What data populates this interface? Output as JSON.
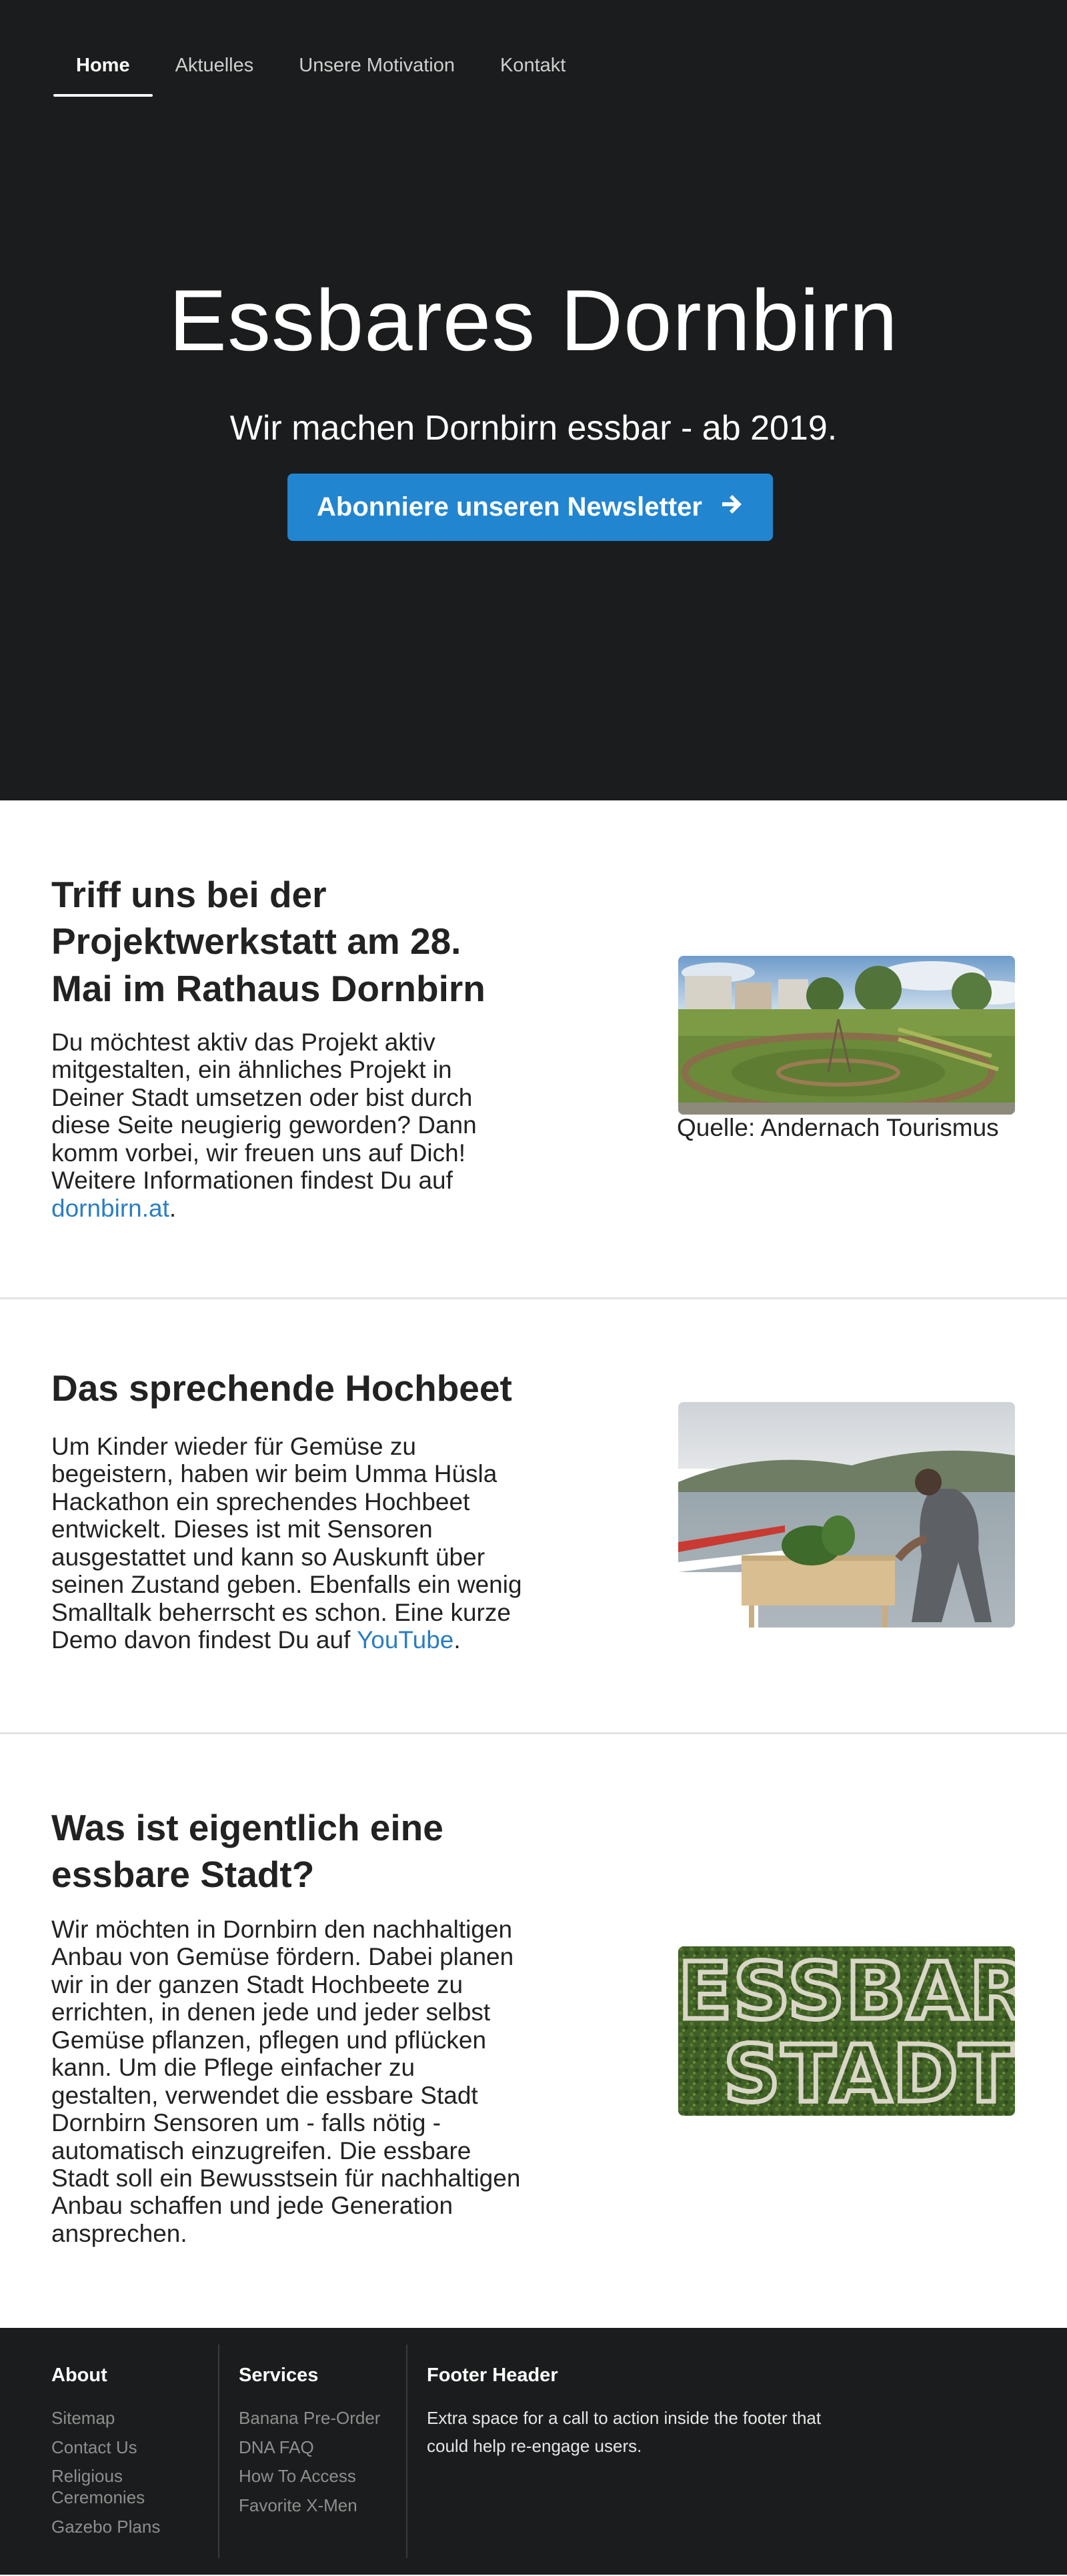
{
  "nav": {
    "items": [
      {
        "label": "Home"
      },
      {
        "label": "Aktuelles"
      },
      {
        "label": "Unsere Motivation"
      },
      {
        "label": "Kontakt"
      }
    ]
  },
  "hero": {
    "title": "Essbares Dornbirn",
    "subtitle": "Wir machen Dornbirn essbar - ab 2019.",
    "cta_label": "Abonniere unseren Newsletter",
    "cta_icon": "arrow-right-icon"
  },
  "sections": [
    {
      "title": "Triff uns bei der Projektwerkstatt am 28. Mai im Rathaus Dornbirn",
      "text": "Du möchtest aktiv das Projekt aktiv mitgestalten, ein ähnliches Projekt in Deiner Stadt umsetzen oder bist durch diese Seite neugierig geworden? Dann komm vorbei, wir freuen uns auf Dich! Weitere Informationen findest Du auf ",
      "link": "dornbirn.at",
      "after": ".",
      "caption": "Quelle: Andernach Tourismus"
    },
    {
      "title": "Das sprechende Hochbeet",
      "text": "Um Kinder wieder für Gemüse zu begeistern, haben wir beim Umma Hüsla Hackathon ein sprechendes Hochbeet entwickelt. Dieses ist mit Sensoren ausgestattet und kann so Auskunft über seinen Zustand geben. Ebenfalls ein wenig Smalltalk beherrscht es schon. Eine kurze Demo davon findest Du auf ",
      "link": "YouTube",
      "after": "."
    },
    {
      "title": "Was ist eigentlich eine essbare Stadt?",
      "text": "Wir möchten in Dornbirn den nachhaltigen Anbau von Gemüse fördern. Dabei planen wir in der ganzen Stadt Hochbeete zu errichten, in denen jede und jeder selbst Gemüse pflanzen, pflegen und pflücken kann. Um die Pflege einfacher zu gestalten, verwendet die essbare Stadt Dornbirn Sensoren um - falls nötig - automatisch einzugreifen. Die essbare Stadt soll ein Bewusstsein für nachhaltigen Anbau schaffen und jede Generation ansprechen.",
      "image_text": [
        "ESSBARE",
        "STADT"
      ]
    }
  ],
  "footer": {
    "about": {
      "header": "About",
      "links": [
        "Sitemap",
        "Contact Us",
        "Religious Ceremonies",
        "Gazebo Plans"
      ]
    },
    "services": {
      "header": "Services",
      "links": [
        "Banana Pre-Order",
        "DNA FAQ",
        "How To Access",
        "Favorite X-Men"
      ]
    },
    "extra": {
      "header": "Footer Header",
      "text": "Extra space for a call to action inside the footer that could help re-engage users."
    }
  },
  "colors": {
    "dark_bg": "#1b1c1d",
    "primary_button": "#2185d0",
    "link": "#2b7ec1"
  }
}
